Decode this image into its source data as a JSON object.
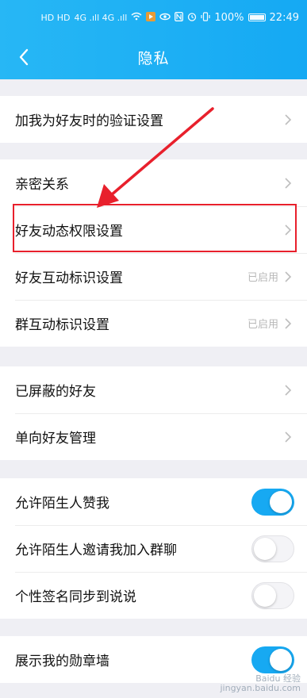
{
  "status_bar": {
    "network_badges": "HD HD",
    "signal": "4G .ıll 4G .ıll",
    "battery_percent": "100%",
    "time": "22:49"
  },
  "nav": {
    "title": "隐私",
    "back_icon": "chevron-left-icon"
  },
  "sections": [
    {
      "rows": [
        {
          "label": "加我为好友时的验证设置",
          "right_text": "",
          "control": "chevron"
        }
      ]
    },
    {
      "rows": [
        {
          "label": "亲密关系",
          "right_text": "",
          "control": "chevron"
        },
        {
          "label": "好友动态权限设置",
          "right_text": "",
          "control": "chevron"
        },
        {
          "label": "好友互动标识设置",
          "right_text": "已启用",
          "control": "chevron"
        },
        {
          "label": "群互动标识设置",
          "right_text": "已启用",
          "control": "chevron"
        }
      ]
    },
    {
      "rows": [
        {
          "label": "已屏蔽的好友",
          "right_text": "",
          "control": "chevron"
        },
        {
          "label": "单向好友管理",
          "right_text": "",
          "control": "chevron"
        }
      ]
    },
    {
      "rows": [
        {
          "label": "允许陌生人赞我",
          "control": "toggle",
          "on": true
        },
        {
          "label": "允许陌生人邀请我加入群聊",
          "control": "toggle",
          "on": false
        },
        {
          "label": "个性签名同步到说说",
          "control": "toggle",
          "on": false
        }
      ]
    },
    {
      "rows": [
        {
          "label": "展示我的勋章墙",
          "control": "toggle",
          "on": true
        }
      ]
    }
  ],
  "annotation": {
    "color": "#e8202c"
  },
  "watermark": {
    "line1": "Baidu 经验",
    "line2": "jingyan.baidu.com"
  },
  "colors": {
    "header": "#1aaef4",
    "toggle_on": "#17a9f2",
    "background": "#efeff4"
  }
}
